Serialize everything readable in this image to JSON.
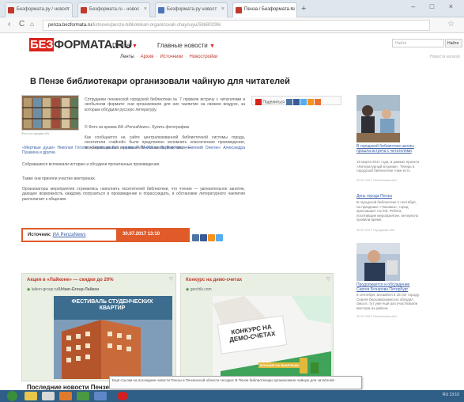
{
  "browser": {
    "tabs": [
      {
        "title": "Безформата.ру / новост",
        "active": false
      },
      {
        "title": "Безформата.ru - новос",
        "active": false
      },
      {
        "title": "Безформата.ру новост",
        "active": false
      },
      {
        "title": "Пенза / Безформата.ru",
        "active": true
      }
    ],
    "new_tab": "+",
    "window_buttons": "– □ ×",
    "back": "‹",
    "reload": "C",
    "url_host": "penza.bezformata.ru",
    "url_path": "/listnews/penze-bibliotekari-organizovali-chaynuyu/59680296/"
  },
  "site": {
    "logo_red": "БЕЗ",
    "logo_rest": "ФОРМАТА.RU",
    "city": "Пенза",
    "main_news": "Главные новости",
    "subnav": [
      "Ленты",
      "Архив",
      "Источники",
      "Новостройки"
    ],
    "search_placeholder": "Найти",
    "search_button": "Найти",
    "all_categories": "Новости каталог"
  },
  "article": {
    "headline": "В Пензе библиотекари организовали чайную для читателей",
    "photo_caption": "Фото из архива ИА",
    "lead": "Сотрудники пензенской городской библиотеки № 7 провели встречу с читателями в необычном формате: они организовали для них чаепитие на свежем воздухе, за которым обсудили русскую литературу.",
    "photo_credit": "© Фото из архива ИА «PenzaNews». Купить фотографию",
    "para1": "Как сообщается на сайте централизованной библиотечной системы города, посетители «чайной» было предложено вспомнить классические произведения, описывающие быт и нравы XVIII–XIX веков. В их числе —",
    "para1_links": "«Мертвые души» Николая Гоголя, «Герой нашего времени» Михаила Лермонтова, «Евгений Онегин» Александра Пушкина и другие.",
    "para2": "Собравшиеся вспомнили историю и обсудили прочитанные произведения.",
    "para3": "Также они приняли участие викторинах.",
    "para4": "Организаторы мероприятия стремились наполнить посетителей библиотеки, что чтение — увлекательное занятие, дающее возможность каждому погрузиться в произведение и порассуждать, в обстановке литературного чаепития располагает к общению.",
    "share_label": "Поделиться",
    "source_label": "Источник:",
    "source_name": "ИА PenzaNews",
    "date": "30.07.2017  13:10"
  },
  "ads": [
    {
      "title": "Акция в «Лайконе» — скидки до 20%",
      "url_host": "laikon-group.ru",
      "url_path": "/Urban-Group-Лайкон",
      "banner": "ФЕСТИВАЛЬ СТУДЕНЧЕСКИХ КВАРТИР"
    },
    {
      "title": "Конкурс на демо-счетах",
      "url_host": "gerchik.com",
      "url_path": "",
      "banner_line1": "КОНКУРС НА",
      "banner_line2": "ДЕМО-СЧЕТАХ",
      "banner_cta": "БОЛЬШЕ НА ВЫИГРЫШ"
    }
  ],
  "latest_heading": "Последние новости Пензе",
  "tooltip": "Ещё ссылки на последние новости Пензы и Пензенской области сегодня: В Пензе библиотекари организовали чайную для читателей",
  "sidebar": {
    "item1_link": "В городской библиотеке школы прошла встреча с читателями",
    "item1_text": "10 марта 2017 года, в рамках проекта «Литературный вторник». Теперь в городской библиотеке тоже есть",
    "item1_date": "30.07.2017 Пензенская обл.",
    "item2_link": "День города Пензы",
    "item2_text": "В городской библиотеке 2 сентября, на празднике «Чиновка», город приглашает гостей. Ребята, посетившие мероприятие, интересно провели время.",
    "item2_date": "30.07.2017 Городская обл.",
    "item3_link": "Продолжается и обсуждение Сергея Бочарова Петербург",
    "item3_text": "8 сентября, ансамбля в 28 лет городу. Сергей бескомпромиссно обсудил смысл, тут уже ещё раз участвовали мастера из района",
    "item3_date": "30.07.2017 Пензенская обл."
  },
  "taskbar": {
    "tray": "RU  13:10"
  }
}
